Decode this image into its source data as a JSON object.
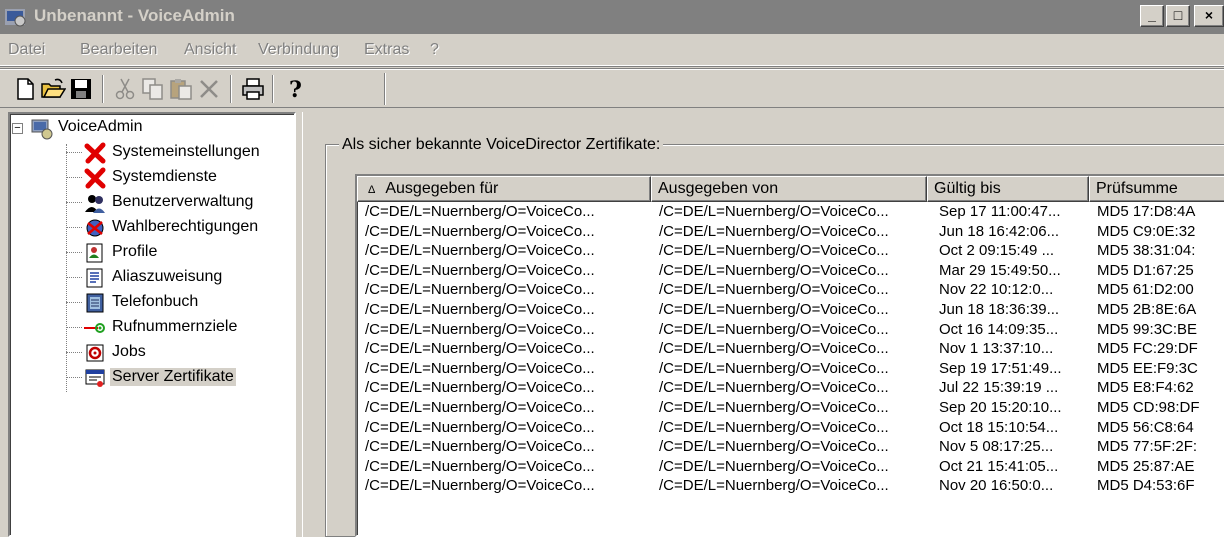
{
  "window": {
    "title": "Unbenannt - VoiceAdmin",
    "buttons": [
      "_",
      "□",
      "×"
    ]
  },
  "menu": [
    "Datei",
    "Bearbeiten",
    "Ansicht",
    "Verbindung",
    "Extras",
    "?"
  ],
  "toolbar": {
    "buttons": [
      "new-icon",
      "open-icon",
      "save-icon",
      "cut-icon",
      "copy-icon",
      "paste-icon",
      "delete-icon",
      "print-icon",
      "help-icon"
    ]
  },
  "tree": {
    "root_label": "VoiceAdmin",
    "expander": "−",
    "items": [
      {
        "label": "Systemeinstellungen",
        "icon": "red-x-icon"
      },
      {
        "label": "Systemdienste",
        "icon": "red-x-icon"
      },
      {
        "label": "Benutzerverwaltung",
        "icon": "users-icon"
      },
      {
        "label": "Wahlberechtigungen",
        "icon": "permissions-icon"
      },
      {
        "label": "Profile",
        "icon": "profile-icon"
      },
      {
        "label": "Aliaszuweisung",
        "icon": "alias-icon"
      },
      {
        "label": "Telefonbuch",
        "icon": "phonebook-icon"
      },
      {
        "label": "Rufnummernziele",
        "icon": "target-arrow-icon"
      },
      {
        "label": "Jobs",
        "icon": "jobs-icon"
      },
      {
        "label": "Server Zertifikate",
        "icon": "certificate-icon",
        "selected": true
      }
    ]
  },
  "certificates": {
    "group_label": "Als sicher bekannte VoiceDirector Zertifikate:",
    "sort_indicator": "Δ",
    "columns": [
      "Ausgegeben für",
      "Ausgegeben von",
      "Gültig bis",
      "Prüfsumme"
    ],
    "rows": [
      [
        "/C=DE/L=Nuernberg/O=VoiceCo...",
        "/C=DE/L=Nuernberg/O=VoiceCo...",
        "Sep 17 11:00:47...",
        "MD5 17:D8:4A"
      ],
      [
        "/C=DE/L=Nuernberg/O=VoiceCo...",
        "/C=DE/L=Nuernberg/O=VoiceCo...",
        "Jun 18 16:42:06...",
        "MD5 C9:0E:32"
      ],
      [
        "/C=DE/L=Nuernberg/O=VoiceCo...",
        "/C=DE/L=Nuernberg/O=VoiceCo...",
        "Oct  2 09:15:49 ...",
        "MD5 38:31:04:"
      ],
      [
        "/C=DE/L=Nuernberg/O=VoiceCo...",
        "/C=DE/L=Nuernberg/O=VoiceCo...",
        "Mar 29 15:49:50...",
        "MD5 D1:67:25"
      ],
      [
        "/C=DE/L=Nuernberg/O=VoiceCo...",
        "/C=DE/L=Nuernberg/O=VoiceCo...",
        "Nov 22 10:12:0...",
        "MD5 61:D2:00"
      ],
      [
        "/C=DE/L=Nuernberg/O=VoiceCo...",
        "/C=DE/L=Nuernberg/O=VoiceCo...",
        "Jun 18 18:36:39...",
        "MD5 2B:8E:6A"
      ],
      [
        "/C=DE/L=Nuernberg/O=VoiceCo...",
        "/C=DE/L=Nuernberg/O=VoiceCo...",
        "Oct 16 14:09:35...",
        "MD5 99:3C:BE"
      ],
      [
        "/C=DE/L=Nuernberg/O=VoiceCo...",
        "/C=DE/L=Nuernberg/O=VoiceCo...",
        "Nov  1 13:37:10...",
        "MD5 FC:29:DF"
      ],
      [
        "/C=DE/L=Nuernberg/O=VoiceCo...",
        "/C=DE/L=Nuernberg/O=VoiceCo...",
        "Sep 19 17:51:49...",
        "MD5 EE:F9:3C"
      ],
      [
        "/C=DE/L=Nuernberg/O=VoiceCo...",
        "/C=DE/L=Nuernberg/O=VoiceCo...",
        "Jul 22 15:39:19 ...",
        "MD5 E8:F4:62"
      ],
      [
        "/C=DE/L=Nuernberg/O=VoiceCo...",
        "/C=DE/L=Nuernberg/O=VoiceCo...",
        "Sep 20 15:20:10...",
        "MD5 CD:98:DF"
      ],
      [
        "/C=DE/L=Nuernberg/O=VoiceCo...",
        "/C=DE/L=Nuernberg/O=VoiceCo...",
        "Oct 18 15:10:54...",
        "MD5 56:C8:64"
      ],
      [
        "/C=DE/L=Nuernberg/O=VoiceCo...",
        "/C=DE/L=Nuernberg/O=VoiceCo...",
        "Nov  5 08:17:25...",
        "MD5 77:5F:2F:"
      ],
      [
        "/C=DE/L=Nuernberg/O=VoiceCo...",
        "/C=DE/L=Nuernberg/O=VoiceCo...",
        "Oct 21 15:41:05...",
        "MD5 25:87:AE"
      ],
      [
        "/C=DE/L=Nuernberg/O=VoiceCo...",
        "/C=DE/L=Nuernberg/O=VoiceCo...",
        "Nov 20 16:50:0...",
        "MD5 D4:53:6F"
      ]
    ]
  }
}
